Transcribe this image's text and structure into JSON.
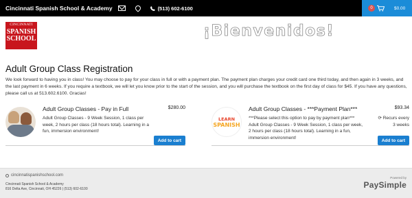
{
  "topbar": {
    "school_name": "Cincinnati Spanish School & Academy",
    "phone": "(513) 602-6100"
  },
  "cart": {
    "count": "0",
    "total": "$0.00"
  },
  "logo": {
    "line1": "CINCINNATI",
    "line2": "SPANISH",
    "line3": "SCHOOL"
  },
  "welcome": "¡Bienvenidos!",
  "page_title": "Adult Group Class Registration",
  "intro": "We look forward to having you in class! You may choose to pay for your class in full or with a payment plan. The payment plan charges your credit card one third today, and then again in 3 weeks, and the last payment in 6 weeks. If you require a textbook, we will let you know prior to the start of the session, and you will purchase the textbook on the first day of class for $45. If you have any questions, please call us at 513.602.6100. Gracias!",
  "products": [
    {
      "title": "Adult Group Classes - Pay in Full",
      "price": "$280.00",
      "description": "Adult Group Classes - 9 Week Session, 1 class per week, 2 hours per class (18 hours total). Learning in a fun, immersion environment!",
      "button": "Add to cart"
    },
    {
      "title": "Adult Group Classes - ***Payment Plan***",
      "price": "$93.34",
      "description": "***Please select this option to pay by payment plan*** Adult Group Classes - 9 Week Session, 1 class per week, 2 hours per class (18 hours total). Learning in a fun, immersion environment!",
      "recurs": "Recurs every 3 weeks",
      "button": "Add to cart",
      "thumb_line1": "LEARN",
      "thumb_line2": "SPANISH"
    }
  ],
  "footer": {
    "site": "cincinnatispanishschool.com",
    "address_line1": "Cincinnati Spanish School & Academy",
    "address_line2": "816 Delta Ave, Cincinnati, OH 45226 | (513) 602-6100",
    "powered_by": "Powered by",
    "brand": "PaySimple"
  },
  "colors": {
    "topbar": "#000000",
    "cart_bar": "#1b8cd8",
    "button": "#1a7fd0",
    "logo_red": "#c8161d"
  }
}
